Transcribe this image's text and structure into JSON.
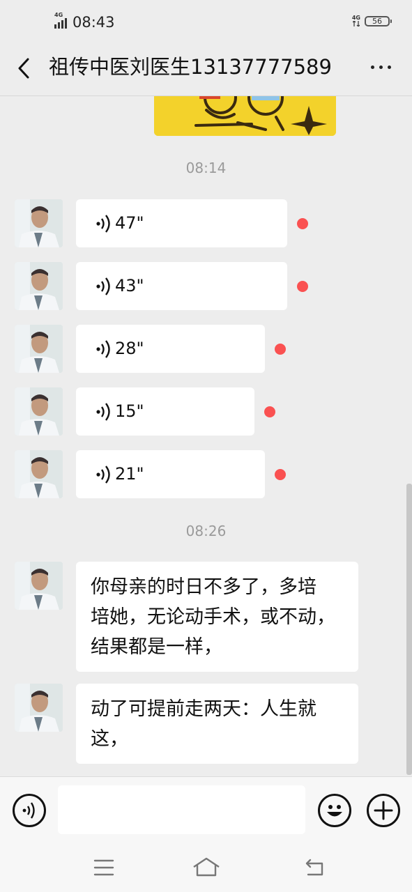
{
  "status": {
    "time": "08:43",
    "network_left": "4G",
    "network_right": "4G",
    "battery": "56"
  },
  "header": {
    "title": "祖传中医刘医生13137777589"
  },
  "chat": {
    "timestamp_1": "08:14",
    "voice_messages": [
      {
        "duration": "47\"",
        "unread": true
      },
      {
        "duration": "43\"",
        "unread": true
      },
      {
        "duration": "28\"",
        "unread": true
      },
      {
        "duration": "15\"",
        "unread": true
      },
      {
        "duration": "21\"",
        "unread": true
      }
    ],
    "timestamp_2": "08:26",
    "text_messages": [
      {
        "lines": [
          "你母亲的时日不多了，多培",
          "培她，无论动手术，或不动，",
          "结果都是一样，"
        ]
      },
      {
        "lines": [
          "动了可提前走两天：人生就",
          "这，"
        ]
      }
    ]
  },
  "icons": {
    "back": "chevron-left-icon",
    "more": "more-dots-icon",
    "voice": "voice-wave-icon",
    "voice_input": "voice-input-icon",
    "emoji": "emoji-icon",
    "plus": "plus-icon",
    "nav_menu": "menu-icon",
    "nav_home": "home-icon",
    "nav_back": "back-arrow-icon"
  },
  "colors": {
    "unread_dot": "#fa5151",
    "background": "#ededed",
    "bubble": "#ffffff"
  }
}
